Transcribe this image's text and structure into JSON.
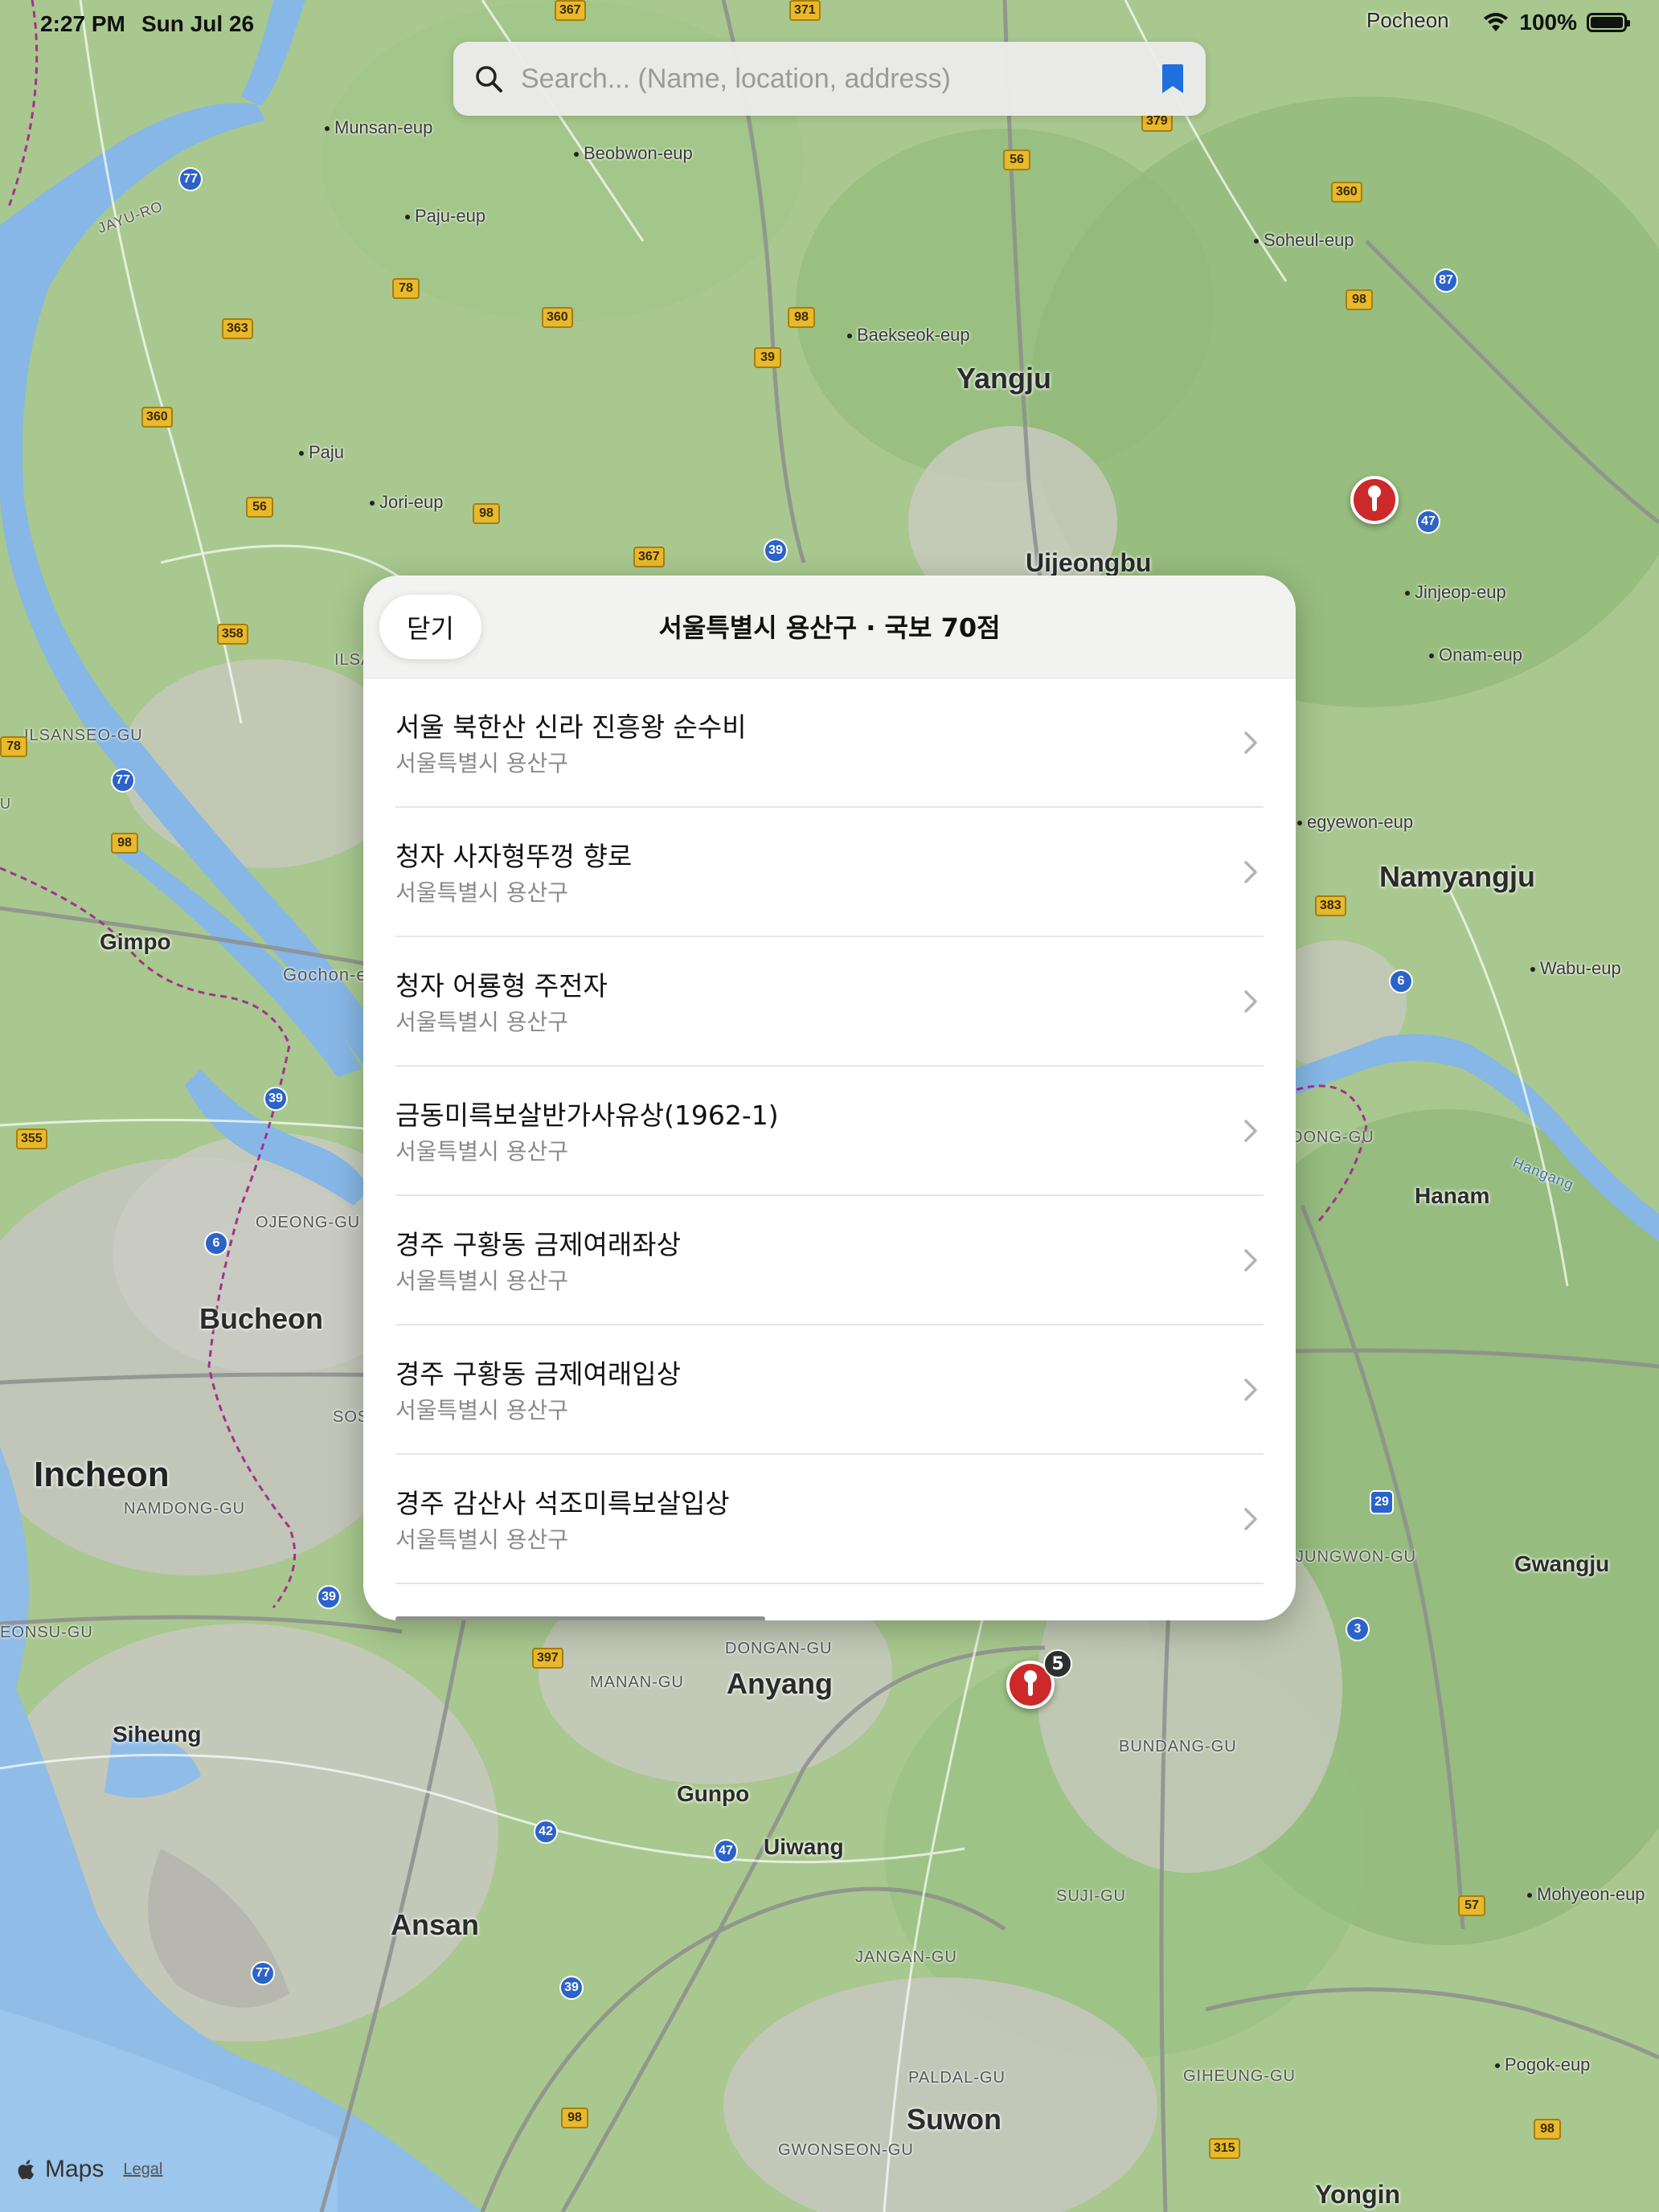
{
  "status_bar": {
    "time": "2:27 PM",
    "date": "Sun Jul 26",
    "battery": "100%"
  },
  "search": {
    "placeholder": "Search... (Name, location, address)",
    "value": ""
  },
  "sheet": {
    "close_label": "닫기",
    "title": "서울특별시 용산구 · 국보 70점",
    "items": [
      {
        "name": "서울 북한산 신라 진흥왕 순수비",
        "region": "서울특별시 용산구"
      },
      {
        "name": "청자 사자형뚜껑 향로",
        "region": "서울특별시 용산구"
      },
      {
        "name": "청자 어룡형 주전자",
        "region": "서울특별시 용산구"
      },
      {
        "name": "금동미륵보살반가사유상(1962-1)",
        "region": "서울특별시 용산구"
      },
      {
        "name": "경주 구황동 금제여래좌상",
        "region": "서울특별시 용산구"
      },
      {
        "name": "경주 구황동 금제여래입상",
        "region": "서울특별시 용산구"
      },
      {
        "name": "경주 감산사 석조미륵보살입상",
        "region": "서울특별시 용산구"
      }
    ]
  },
  "map": {
    "places": {
      "pocheon": "Pocheon",
      "munsan": "Munsan-eup",
      "beobwon": "Beobwon-eup",
      "paju_eup": "Paju-eup",
      "soheul": "Soheul-eup",
      "baekseok": "Baekseok-eup",
      "yangju": "Yangju",
      "paju": "Paju",
      "jori": "Jori-eup",
      "uijeongbu": "Uijeongbu",
      "jinjeop": "Jinjeop-eup",
      "onam": "Onam-eup",
      "ilsanseo": "ILSANSEO-GU",
      "jinggyewon": "egyewon-eup",
      "namyangju": "Namyangju",
      "gimpo": "Gimpo",
      "gochon": "Gochon-e",
      "wabu": "Wabu-eup",
      "hanam": "Hanam",
      "ojeong": "OJEONG-GU",
      "bucheon": "Bucheon",
      "incheon": "Incheon",
      "namdong": "NAMDONG-GU",
      "gwangju": "Gwangju",
      "dongan": "DONGAN-GU",
      "manan": "MANAN-GU",
      "anyang": "Anyang",
      "siheung": "Siheung",
      "bundang": "BUNDANG-GU",
      "gunpo": "Gunpo",
      "uiwang": "Uiwang",
      "ansan": "Ansan",
      "suji": "SUJI-GU",
      "mohyeon": "Mohyeon-eup",
      "jangan": "JANGAN-GU",
      "paldal": "PALDAL-GU",
      "giheung": "GIHEUNG-GU",
      "pogok": "Pogok-eup",
      "suwon": "Suwon",
      "gwonseon": "GWONSEON-GU",
      "yongin": "Yongin",
      "eonsu": "EONSU-GU",
      "ilsa": "ILSA",
      "sos": "SOS",
      "dong_gu": "DONG-GU",
      "jungwon": "JUNGWON-GU",
      "jayu_ro": "JAYU-RO",
      "hangang": "Hangang",
      "u": "U"
    },
    "shields": {
      "s367a": "367",
      "s371": "371",
      "s379": "379",
      "s56a": "56",
      "s360a": "360",
      "s98a": "98",
      "s87": "87",
      "s77a": "77",
      "s78a": "78",
      "s363": "363",
      "s360b": "360",
      "s98b": "98",
      "s39a": "39",
      "s360c": "360",
      "s56b": "56",
      "s98c": "98",
      "s39b": "39",
      "s367b": "367",
      "s47a": "47",
      "s358": "358",
      "s78b": "78",
      "s77b": "77",
      "s98d": "98",
      "s383": "383",
      "s6a": "6",
      "s39c": "39",
      "s355": "355",
      "s6b": "6",
      "s29": "29",
      "s39d": "39",
      "s397": "397",
      "s3": "3",
      "s42": "42",
      "s47b": "47",
      "s57": "57",
      "s77c": "77",
      "s39e": "39",
      "s98e": "98",
      "s315": "315",
      "s98f": "98"
    },
    "cluster_count": "5",
    "attribution": {
      "maps_label": "Maps",
      "legal_label": "Legal"
    }
  },
  "colors": {
    "accent": "#1f6fdd",
    "pin": "#cc2a2a",
    "road_major": "#f4d36a",
    "water": "#86b7e6",
    "land": "#a9c98f"
  }
}
